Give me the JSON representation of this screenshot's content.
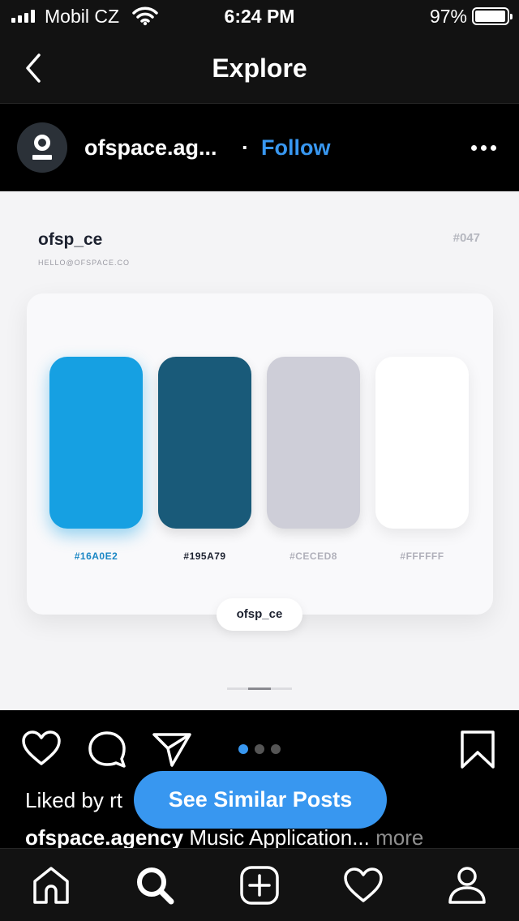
{
  "status_bar": {
    "carrier": "Mobil CZ",
    "time": "6:24 PM",
    "battery": "97%",
    "battery_level": 0.97
  },
  "nav": {
    "title": "Explore"
  },
  "post": {
    "username": "ofspace.ag...",
    "separator": "·",
    "follow_label": "Follow"
  },
  "media": {
    "brand": "ofsp_ce",
    "email": "HELLO@OFSPACE.CO",
    "issue": "#047",
    "swatches": [
      {
        "hex": "#16A0E2",
        "color": "#16A0E2",
        "label_color": "#1a86c4"
      },
      {
        "hex": "#195A79",
        "color": "#195A79",
        "label_color": "#1d2230"
      },
      {
        "hex": "#CECED8",
        "color": "#CECED8",
        "label_color": "#b0b0ba"
      },
      {
        "hex": "#FFFFFF",
        "color": "#FFFFFF",
        "label_color": "#b0b0ba"
      }
    ],
    "footer_pill": "ofsp_ce"
  },
  "carousel": {
    "pages": 3,
    "active": 1
  },
  "liked": {
    "prefix": "Liked by rt"
  },
  "caption": {
    "username": "ofspace.agency",
    "text": " Music Application...",
    "more": " more"
  },
  "similar_button": {
    "label": "See Similar Posts"
  },
  "colors": {
    "accent": "#3897f0",
    "background": "#000000",
    "bar": "#121212"
  }
}
